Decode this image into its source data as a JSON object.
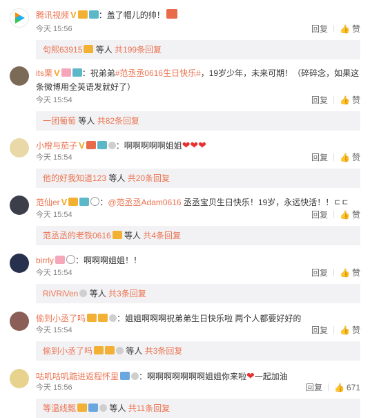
{
  "comments": [
    {
      "user": "腾讯视频",
      "text": "：盖了帽儿的帅！",
      "time": "今天 15:56",
      "reply": "回复",
      "like": "赞",
      "reply_box": {
        "name": "句熙63915",
        "mid": " 等人 ",
        "count": "共199条回复"
      }
    },
    {
      "user": "its栗",
      "text_pre": "：祝弟弟",
      "topic": "#范丞丞0616生日快乐#",
      "text_post": "，19岁少年，未来可期！（碎碎念，如果这条微博用全英语发就好了）",
      "time": "今天 15:54",
      "reply": "回复",
      "like": "赞",
      "reply_box": {
        "name": "一团葡萄",
        "mid": " 等人 ",
        "count": "共82条回复"
      }
    },
    {
      "user": "小橙与茄子",
      "text": "：啊啊啊啊啊姐姐",
      "time": "今天 15:54",
      "reply": "回复",
      "like": "赞",
      "reply_box": {
        "name": "他的好我知道123",
        "mid": " 等人 ",
        "count": "共20条回复"
      }
    },
    {
      "user": "范仙er",
      "text_pre": "：",
      "at": "@范丞丞Adam0616",
      "text_post": " 丞丞宝贝生日快乐！19岁，永远快活！！ㄷㄷ",
      "time": "今天 15:54",
      "reply": "回复",
      "like": "赞",
      "reply_box": {
        "name": "范丞丞的老铁0616",
        "mid": " 等人 ",
        "count": "共4条回复"
      }
    },
    {
      "user": "birrly",
      "text": "：啊啊啊姐姐！！",
      "time": "今天 15:54",
      "reply": "回复",
      "like": "赞",
      "reply_box": {
        "name": "RiVRiVen",
        "mid": " 等人 ",
        "count": "共3条回复"
      }
    },
    {
      "user": "偷到小丞了吗",
      "text": "：姐姐啊啊啊祝弟弟生日快乐啦 两个人都要好好的",
      "time": "今天 15:54",
      "reply": "回复",
      "like": "赞",
      "reply_box": {
        "name": "偷到小丞了吗",
        "mid": " 等人 ",
        "count": "共3条回复"
      }
    },
    {
      "user": "咕叽咕叽踮进返程怀里",
      "text": "：啊啊啊啊啊啊啊姐姐你来啦",
      "text_post": "一起加油",
      "time": "今天 15:56",
      "reply": "回复",
      "like": "671",
      "reply_box": {
        "name": "等温线甄",
        "mid": " 等人 ",
        "count": "共11条回复"
      }
    }
  ],
  "colors": {
    "accent": "#eb7350",
    "reply_bg": "#f2f2f5",
    "heart": "#e8302f"
  }
}
